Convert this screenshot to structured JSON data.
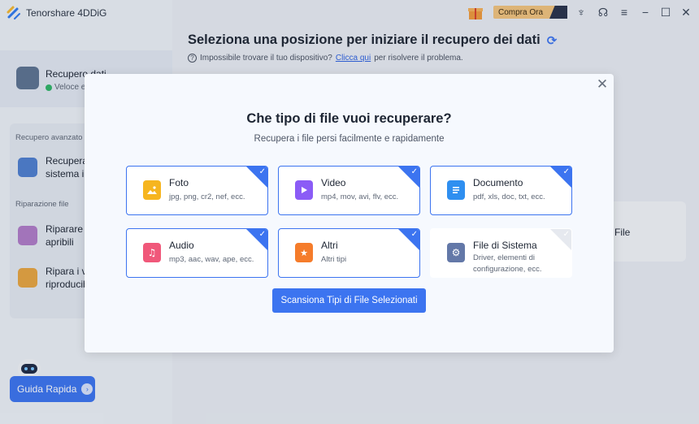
{
  "app": {
    "title": "Tenorshare 4DDiG"
  },
  "topbar": {
    "buy_label": "Compra Ora"
  },
  "sidebar": {
    "main_item": {
      "title": "Recupero dati",
      "subtitle": "Veloce e"
    },
    "advanced_section": "Recupero avanzato",
    "advanced_item": {
      "line1": "Recupera",
      "line2": "sistema in"
    },
    "repair_section": "Riparazione file",
    "repair_items": [
      {
        "line1": "Riparare l",
        "line2": "apribili"
      },
      {
        "line1": "Ripara i vi",
        "line2": "riproducib"
      }
    ],
    "guide_label": "Guida Rapida"
  },
  "main": {
    "title": "Seleziona una posizione per iniziare il recupero dei dati",
    "help_text": "Impossibile trovare il tuo dispositivo?",
    "help_link": "Clicca qui",
    "help_suffix": "per risolvere il problema.",
    "card_label": "File"
  },
  "dialog": {
    "title": "Che tipo di file vuoi recuperare?",
    "subtitle": "Recupera i file persi facilmente e rapidamente",
    "file_types": [
      {
        "name": "Foto",
        "desc": "jpg, png, cr2, nef, ecc.",
        "checked": true,
        "color": "#f6b51f"
      },
      {
        "name": "Video",
        "desc": "mp4, mov, avi, flv, ecc.",
        "checked": true,
        "color": "#8b5cf6"
      },
      {
        "name": "Documento",
        "desc": "pdf, xls, doc, txt, ecc.",
        "checked": true,
        "color": "#2f8ff0"
      },
      {
        "name": "Audio",
        "desc": "mp3, aac, wav, ape, ecc.",
        "checked": true,
        "color": "#f0587a"
      },
      {
        "name": "Altri",
        "desc": "Altri tipi",
        "checked": true,
        "color": "#f57c2b"
      },
      {
        "name": "File di Sistema",
        "desc": "Driver, elementi di configurazione, ecc.",
        "checked": false,
        "color": "#6378a8"
      }
    ],
    "scan_button": "Scansiona Tipi di File Selezionati"
  }
}
